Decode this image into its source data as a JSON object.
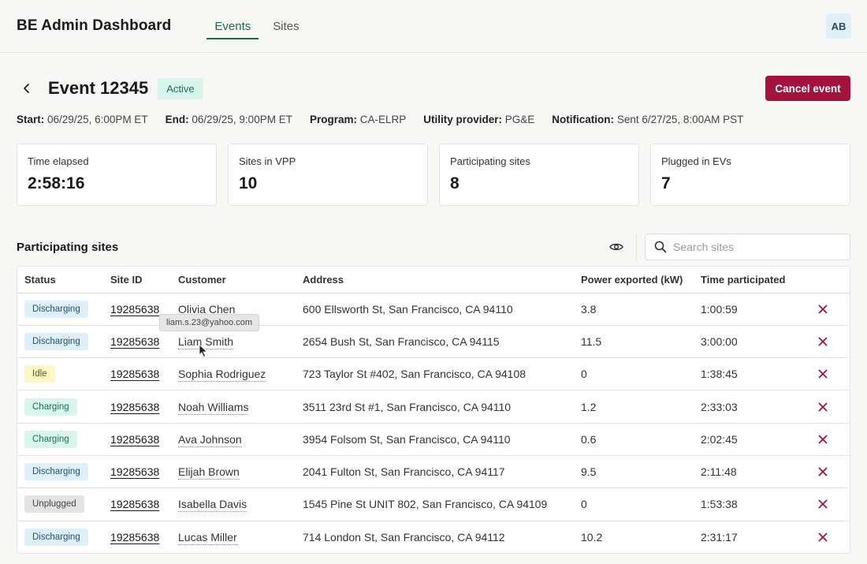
{
  "app": {
    "title": "BE Admin Dashboard",
    "tabs": [
      {
        "label": "Events",
        "active": true
      },
      {
        "label": "Sites",
        "active": false
      }
    ],
    "avatar_initials": "AB"
  },
  "event": {
    "title": "Event 12345",
    "status": "Active",
    "cancel_label": "Cancel event",
    "meta": [
      {
        "label": "Start:",
        "value": "06/29/25, 6:00PM ET"
      },
      {
        "label": "End:",
        "value": "06/29/25, 9:00PM ET"
      },
      {
        "label": "Program:",
        "value": "CA-ELRP"
      },
      {
        "label": "Utility provider:",
        "value": "PG&E"
      },
      {
        "label": "Notification:",
        "value": "Sent 6/27/25, 8:00AM PST"
      }
    ]
  },
  "stats": [
    {
      "label": "Time elapsed",
      "value": "2:58:16"
    },
    {
      "label": "Sites in VPP",
      "value": "10"
    },
    {
      "label": "Participating sites",
      "value": "8"
    },
    {
      "label": "Plugged in EVs",
      "value": "7"
    }
  ],
  "sites_section": {
    "title": "Participating sites",
    "search_placeholder": "Search sites",
    "columns": [
      "Status",
      "Site ID",
      "Customer",
      "Address",
      "Power exported (kW)",
      "Time participated"
    ],
    "rows": [
      {
        "status": "Discharging",
        "site_id": "19285638",
        "customer": "Olivia Chen",
        "address": "600 Ellsworth St, San Francisco, CA 94110",
        "power": "3.8",
        "time": "1:00:59"
      },
      {
        "status": "Discharging",
        "site_id": "19285638",
        "customer": "Liam Smith",
        "address": "2654 Bush St, San Francisco, CA 94115",
        "power": "11.5",
        "time": "3:00:00"
      },
      {
        "status": "Idle",
        "site_id": "19285638",
        "customer": "Sophia Rodriguez",
        "address": "723 Taylor St #402, San Francisco, CA 94108",
        "power": "0",
        "time": "1:38:45"
      },
      {
        "status": "Charging",
        "site_id": "19285638",
        "customer": "Noah Williams",
        "address": "3511 23rd St #1, San Francisco, CA 94110",
        "power": "1.2",
        "time": "2:33:03"
      },
      {
        "status": "Charging",
        "site_id": "19285638",
        "customer": "Ava Johnson",
        "address": "3954 Folsom St, San Francisco, CA 94110",
        "power": "0.6",
        "time": "2:02:45"
      },
      {
        "status": "Discharging",
        "site_id": "19285638",
        "customer": "Elijah Brown",
        "address": "2041 Fulton St, San Francisco, CA 94117",
        "power": "9.5",
        "time": "2:11:48"
      },
      {
        "status": "Unplugged",
        "site_id": "19285638",
        "customer": "Isabella Davis",
        "address": "1545 Pine St UNIT 802, San Francisco, CA 94109",
        "power": "0",
        "time": "1:53:38"
      },
      {
        "status": "Discharging",
        "site_id": "19285638",
        "customer": "Lucas Miller",
        "address": "714 London St, San Francisco, CA 94112",
        "power": "10.2",
        "time": "2:31:17"
      }
    ],
    "tooltip": "liam.s.23@yahoo.com"
  },
  "status_colors": {
    "Discharging": {
      "bg": "#dff0fa",
      "fg": "#26506b"
    },
    "Idle": {
      "bg": "#fdf6c7",
      "fg": "#6b5a14"
    },
    "Charging": {
      "bg": "#d8f6ec",
      "fg": "#1f6e52"
    },
    "Unplugged": {
      "bg": "#e3e3e3",
      "fg": "#444444"
    }
  },
  "colors": {
    "accent": "#1c6a4a",
    "danger": "#a4133c"
  },
  "icons": {
    "back": "chevron-left-icon",
    "visibility": "eye-icon",
    "search": "search-icon",
    "remove": "close-icon"
  }
}
